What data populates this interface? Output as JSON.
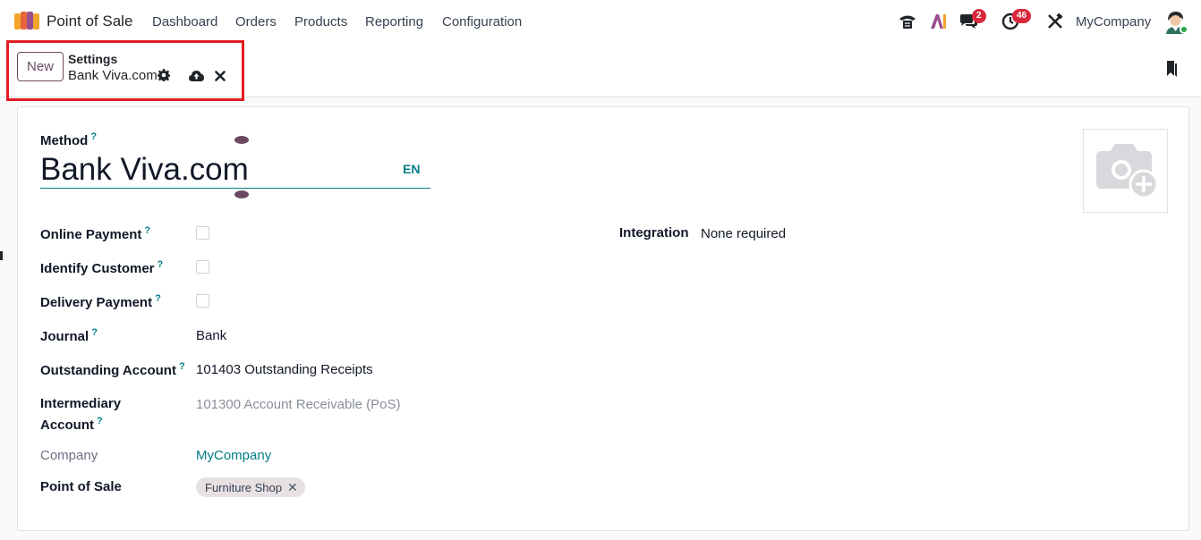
{
  "navbar": {
    "app_name": "Point of Sale",
    "menu": [
      "Dashboard",
      "Orders",
      "Products",
      "Reporting",
      "Configuration"
    ],
    "messages_badge": "2",
    "activities_badge": "46",
    "company": "MyCompany",
    "icons": [
      "phone-icon",
      "ai-icon",
      "chat-icon",
      "clock-icon",
      "tools-icon"
    ]
  },
  "control_panel": {
    "new_label": "New",
    "breadcrumb_parent": "Settings",
    "breadcrumb_current": "Bank Viva.com"
  },
  "form": {
    "method_label": "Method",
    "method_value": "Bank Viva.com",
    "lang": "EN",
    "online_payment_label": "Online Payment",
    "identify_customer_label": "Identify Customer",
    "delivery_payment_label": "Delivery Payment",
    "journal_label": "Journal",
    "journal_value": "Bank",
    "outstanding_label": "Outstanding Account",
    "outstanding_value": "101403 Outstanding Receipts",
    "intermediary_label_1": "Intermediary",
    "intermediary_label_2": "Account",
    "intermediary_value": "101300 Account Receivable (PoS)",
    "company_label": "Company",
    "company_value": "MyCompany",
    "pos_label": "Point of Sale",
    "pos_tag": "Furniture Shop",
    "integration_label": "Integration",
    "integration_value": "None required",
    "help_mark": "?"
  },
  "colors": {
    "accent": "#017e84",
    "brand": "#6b4a63",
    "highlight": "#e31b23",
    "badge": "#d9283b"
  }
}
